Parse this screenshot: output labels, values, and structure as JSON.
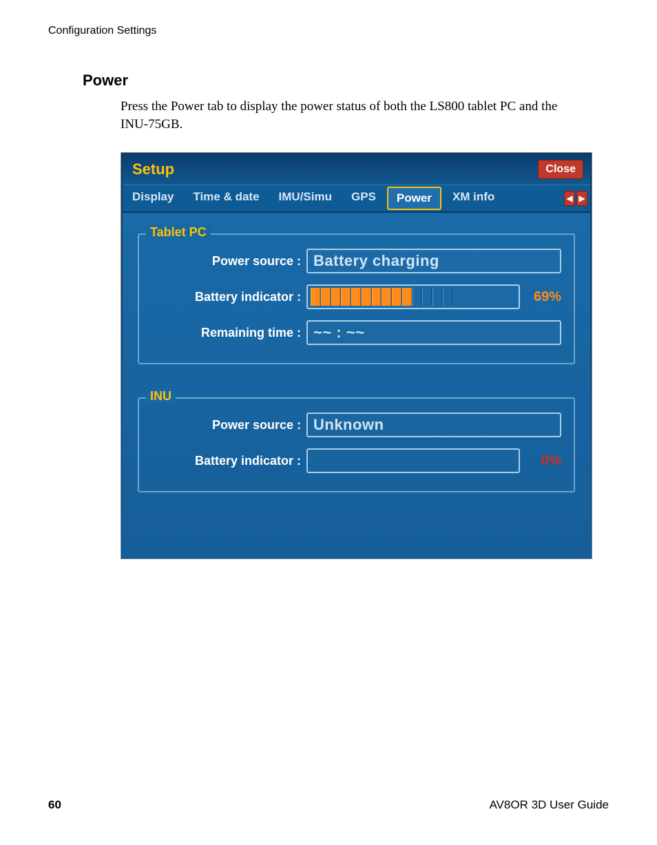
{
  "page_header": "Configuration Settings",
  "section_title": "Power",
  "body_text": "Press the Power tab to display the power status of both the LS800 tablet PC and the INU-75GB.",
  "window": {
    "title": "Setup",
    "close_label": "Close",
    "tabs": {
      "0": {
        "label": "Display"
      },
      "1": {
        "label": "Time & date"
      },
      "2": {
        "label": "IMU/Simu"
      },
      "3": {
        "label": "GPS"
      },
      "4": {
        "label": "Power"
      },
      "5": {
        "label": "XM info"
      }
    },
    "scroll_left_glyph": "◀",
    "scroll_right_glyph": "▶"
  },
  "groups": {
    "tablet": {
      "legend": "Tablet PC",
      "power_source_label": "Power source :",
      "power_source_value": "Battery charging",
      "battery_indicator_label": "Battery indicator :",
      "battery_percent": "69%",
      "remaining_time_label": "Remaining time :",
      "remaining_time_value": "~~ : ~~"
    },
    "inu": {
      "legend": "INU",
      "power_source_label": "Power source :",
      "power_source_value": "Unknown",
      "battery_indicator_label": "Battery indicator :",
      "battery_percent": "0%"
    }
  },
  "footer": {
    "page_number": "60",
    "guide_title": "AV8OR 3D User Guide"
  },
  "chart_data": {
    "type": "bar",
    "title": "Battery indicator",
    "series": [
      {
        "name": "Tablet PC",
        "value": 69,
        "unit": "%",
        "color": "#ff8c1a"
      },
      {
        "name": "INU",
        "value": 0,
        "unit": "%",
        "color": "#d82b1a"
      }
    ],
    "range": [
      0,
      100
    ]
  }
}
